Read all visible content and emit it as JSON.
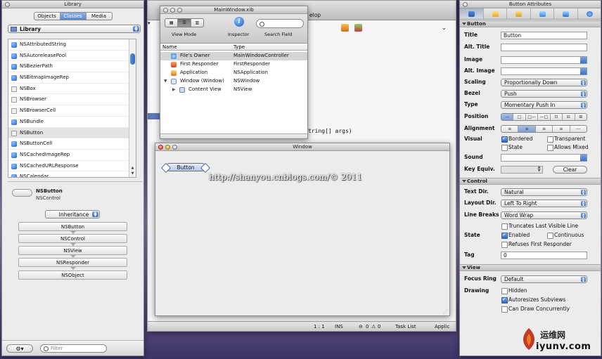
{
  "library": {
    "title": "Library",
    "tabs": [
      "Objects",
      "Classes",
      "Media"
    ],
    "active_tab": "Classes",
    "popup": "Library",
    "items": [
      {
        "label": "NSAttributedString",
        "icon": "class-cube-icon"
      },
      {
        "label": "NSAutoreleasePool",
        "icon": "class-cube-icon"
      },
      {
        "label": "NSBezierPath",
        "icon": "class-cube-icon"
      },
      {
        "label": "NSBitmapImageRep",
        "icon": "class-cube-icon"
      },
      {
        "label": "NSBox",
        "icon": "box-icon"
      },
      {
        "label": "NSBrowser",
        "icon": "browser-icon"
      },
      {
        "label": "NSBrowserCell",
        "icon": "browser-cell-icon"
      },
      {
        "label": "NSBundle",
        "icon": "class-cube-icon"
      },
      {
        "label": "NSButton",
        "icon": "button-icon"
      },
      {
        "label": "NSButtonCell",
        "icon": "class-cube-icon"
      },
      {
        "label": "NSCachedImageRep",
        "icon": "class-cube-icon"
      },
      {
        "label": "NSCachedURLResponse",
        "icon": "class-cube-icon"
      },
      {
        "label": "NSCalendar",
        "icon": "class-cube-icon"
      }
    ],
    "selected": "NSButton",
    "detail": {
      "name": "NSButton",
      "super": "NSControl",
      "mode_popup": "Inheritance",
      "chain": [
        "NSButton",
        "NSControl",
        "NSView",
        "NSResponder",
        "NSObject"
      ]
    },
    "filter_placeholder": "Filter"
  },
  "xcode": {
    "title_fragment": "elop",
    "code_fragment": "tring[] args)",
    "status": {
      "line": "1 : 1",
      "mode": "INS",
      "errors": "0",
      "warnings": "0",
      "task": "Task List",
      "applic": "Applic"
    }
  },
  "xib": {
    "title": "MainWindow.xib",
    "tool_labels": {
      "view_mode": "View Mode",
      "inspector": "Inspector",
      "search": "Search Field"
    },
    "columns": [
      "Name",
      "Type"
    ],
    "rows": [
      {
        "name": "File's Owner",
        "type": "MainWindowController",
        "icon": "files-owner-icon"
      },
      {
        "name": "First Responder",
        "type": "FirstResponder",
        "icon": "first-responder-icon"
      },
      {
        "name": "Application",
        "type": "NSApplication",
        "icon": "application-icon"
      },
      {
        "name": "Window (Window)",
        "type": "NSWindow",
        "icon": "window-icon"
      },
      {
        "name": "Content View",
        "type": "NSView",
        "icon": "view-icon"
      }
    ]
  },
  "window": {
    "title": "Window",
    "button_label": "Button"
  },
  "watermark": "http://shanyou.cnblogs.com/© 2011",
  "inspector": {
    "title": "Button Attributes",
    "sections": {
      "button": "Button",
      "control": "Control",
      "view": "View"
    },
    "labels": {
      "title": "Title",
      "alt_title": "Alt. Title",
      "image": "Image",
      "alt_image": "Alt. Image",
      "scaling": "Scaling",
      "bezel": "Bezel",
      "type": "Type",
      "position": "Position",
      "alignment": "Alignment",
      "visual": "Visual",
      "sound": "Sound",
      "key_equiv": "Key Equiv.",
      "text_dir": "Text Dir.",
      "layout_dir": "Layout Dir.",
      "line_breaks": "Line Breaks",
      "state": "State",
      "tag": "Tag",
      "focus_ring": "Focus Ring",
      "drawing": "Drawing"
    },
    "values": {
      "title": "Button",
      "alt_title": "",
      "scaling": "Proportionally Down",
      "bezel": "Push",
      "type": "Momentary Push In",
      "text_dir": "Natural",
      "layout_dir": "Left To Right",
      "line_breaks": "Word Wrap",
      "tag": "0",
      "focus_ring": "Default",
      "clear": "Clear"
    },
    "checks": {
      "bordered": "Bordered",
      "transparent": "Transparent",
      "state": "State",
      "allows_mixed": "Allows Mixed",
      "truncates": "Truncates Last Visible Line",
      "enabled": "Enabled",
      "continuous": "Continuous",
      "refuses": "Refuses First Responder",
      "hidden": "Hidden",
      "autoresizes": "Autoresizes Subviews",
      "can_draw": "Can Draw Concurrently"
    }
  },
  "logo": {
    "line1": "运维网",
    "line2": "iyunv.com"
  }
}
